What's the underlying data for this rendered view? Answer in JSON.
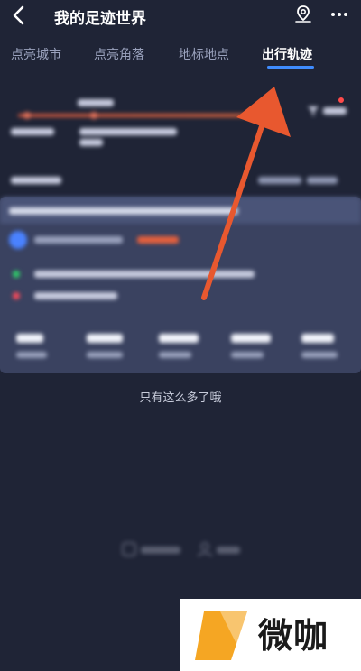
{
  "header": {
    "title": "我的足迹世界",
    "icons": {
      "back": "chevron-left-icon",
      "location": "map-pin-icon",
      "more": "more-dots-icon"
    }
  },
  "tabs": [
    {
      "label": "点亮城市",
      "active": false
    },
    {
      "label": "点亮角落",
      "active": false
    },
    {
      "label": "地标地点",
      "active": false
    },
    {
      "label": "出行轨迹",
      "active": true
    }
  ],
  "list": {
    "end_message": "只有这么多了哦"
  },
  "watermark": {
    "text": "微咖"
  },
  "colors": {
    "background": "#1f2436",
    "card": "#3a4260",
    "accent": "#3f8cff",
    "arrow": "#e8582f",
    "track": "#d45e3c"
  }
}
